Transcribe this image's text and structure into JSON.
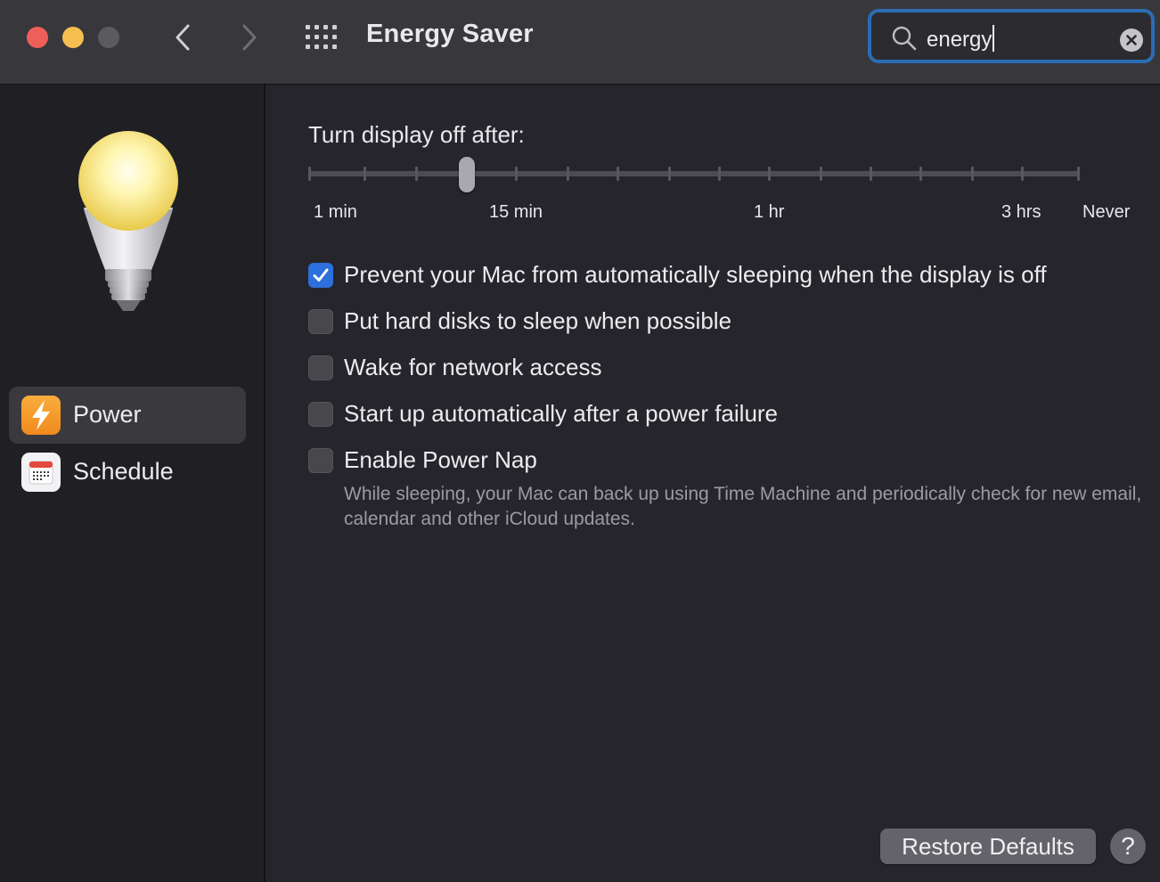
{
  "window": {
    "title": "Energy Saver",
    "controls": [
      "close",
      "minimize",
      "zoom"
    ]
  },
  "toolbar": {
    "back_icon": "chevron-left-icon",
    "forward_icon": "chevron-right-icon",
    "show_all_icon": "grid-icon"
  },
  "search": {
    "value": "energy",
    "icon": "search-icon",
    "clear_icon": "clear-icon"
  },
  "sidebar": {
    "header_icon": "lightbulb-icon",
    "items": [
      {
        "label": "Power",
        "icon": "lightning-bolt-icon",
        "selected": true
      },
      {
        "label": "Schedule",
        "icon": "calendar-icon",
        "selected": false
      }
    ]
  },
  "display_sleep": {
    "label": "Turn display off after:",
    "value": "10 min",
    "tick_labels": [
      "1 min",
      "15 min",
      "1 hr",
      "3 hrs",
      "Never"
    ]
  },
  "options": [
    {
      "label": "Prevent your Mac from automatically sleeping when the display is off",
      "checked": true
    },
    {
      "label": "Put hard disks to sleep when possible",
      "checked": false
    },
    {
      "label": "Wake for network access",
      "checked": false
    },
    {
      "label": "Start up automatically after a power failure",
      "checked": false
    },
    {
      "label": "Enable Power Nap",
      "checked": false
    }
  ],
  "power_nap_note": "While sleeping, your Mac can back up using Time Machine and periodically check for new email, calendar and other iCloud updates.",
  "buttons": {
    "restore_defaults": "Restore Defaults",
    "help": "?"
  },
  "colors": {
    "accent": "#2d6fdc",
    "search_focus_ring": "#2a6db4",
    "close": "#ee5f5a",
    "minimize": "#f5bf4f",
    "power_icon": "#f59a2b"
  }
}
